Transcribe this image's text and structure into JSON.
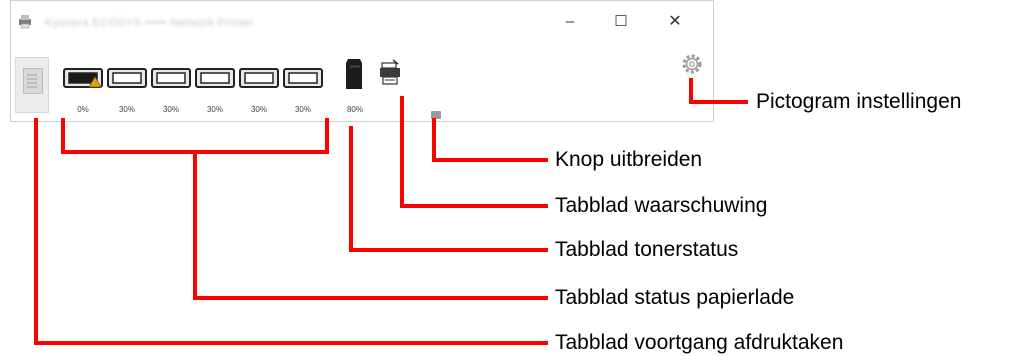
{
  "window": {
    "title": "Kyocera ECOSYS ••••• Network Printer",
    "minimize_glyph": "–",
    "maximize_glyph": "☐",
    "close_glyph": "✕"
  },
  "toolbar": {
    "trays": [
      {
        "id": "tray-1",
        "percent": "0%",
        "warning": true
      },
      {
        "id": "tray-2",
        "percent": "30%",
        "warning": false
      },
      {
        "id": "tray-3",
        "percent": "30%",
        "warning": false
      },
      {
        "id": "tray-4",
        "percent": "30%",
        "warning": false
      },
      {
        "id": "tray-5",
        "percent": "30%",
        "warning": false
      },
      {
        "id": "tray-6",
        "percent": "30%",
        "warning": false
      }
    ],
    "toner_percent": "80%"
  },
  "callouts": {
    "settings_icon": "Pictogram instellingen",
    "expand_button": "Knop uitbreiden",
    "alert_tab": "Tabblad waarschuwing",
    "toner_tab": "Tabblad tonerstatus",
    "paper_tray_tab": "Tabblad status papierlade",
    "print_job_tab": "Tabblad voortgang afdruktaken"
  },
  "colors": {
    "callout_line": "#ff0000",
    "label_text": "#000000",
    "warning": "#e3a21a"
  }
}
